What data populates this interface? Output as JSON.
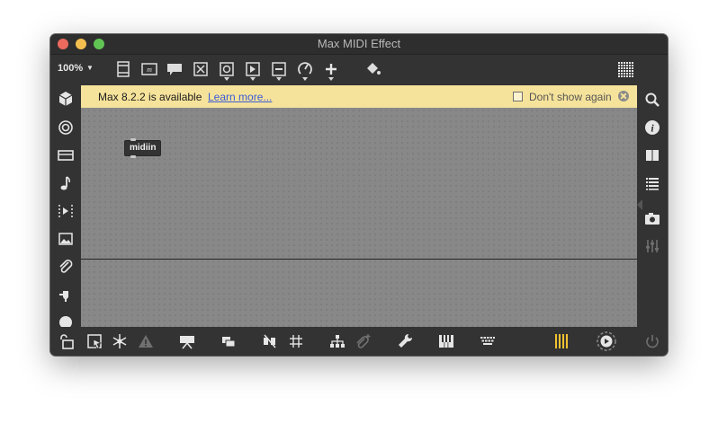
{
  "window": {
    "title": "Max MIDI Effect"
  },
  "toolbar": {
    "zoom": "100%",
    "buttons": [
      "presentation-icon",
      "comment-icon",
      "message-icon",
      "toggle-icon",
      "button-icon",
      "play-icon",
      "slider-icon",
      "dial-icon",
      "plus-icon",
      "paint-bucket-icon",
      "grid-menu-icon"
    ]
  },
  "banner": {
    "message": "Max 8.2.2 is available",
    "link": "Learn more...",
    "checkbox_label": "Don't show again",
    "checked": false
  },
  "patcher": {
    "objects": [
      {
        "text": "midiin"
      }
    ]
  },
  "colors": {
    "banner": "#f6e39b",
    "canvas": "#888888",
    "chrome": "#333333",
    "accent": "#f2c230"
  }
}
